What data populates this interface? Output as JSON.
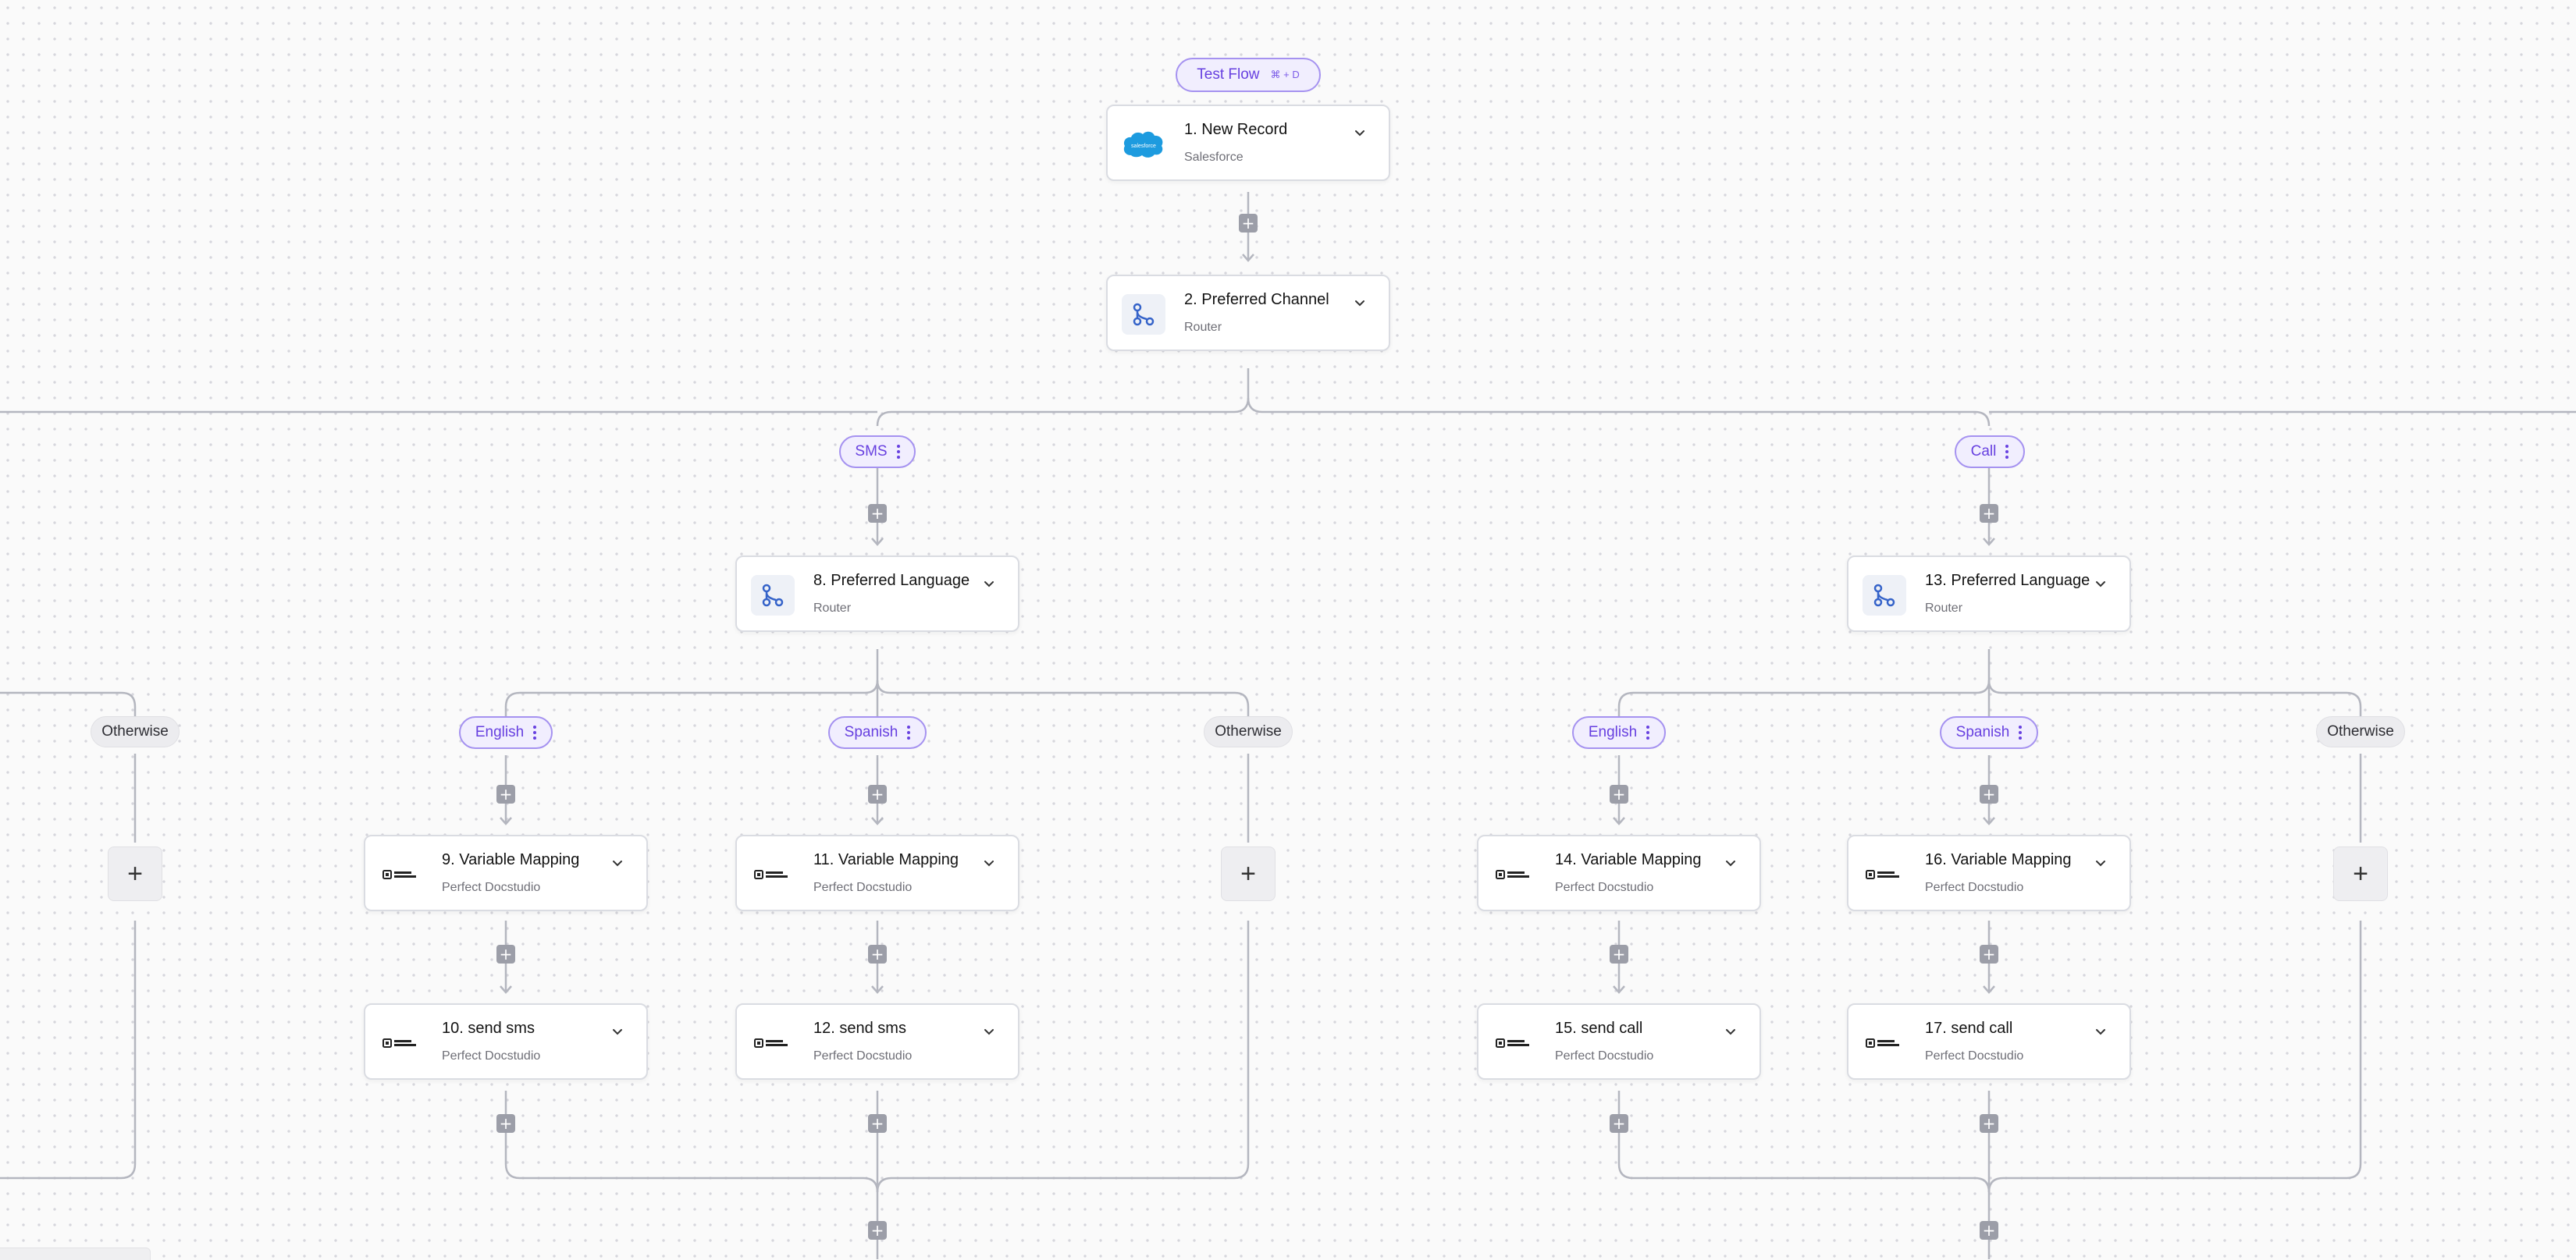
{
  "test_flow": {
    "label": "Test Flow",
    "shortcut": "⌘ + D"
  },
  "steps": [
    {
      "title": "1. New Record",
      "app": "Salesforce",
      "icon": "salesforce-logo-icon"
    },
    {
      "title": "2. Preferred Channel",
      "app": "Router",
      "icon": "router-icon"
    },
    {
      "title": "8. Preferred Language",
      "app": "Router",
      "icon": "router-icon"
    },
    {
      "title": "13. Preferred Language",
      "app": "Router",
      "icon": "router-icon"
    },
    {
      "title": "9. Variable Mapping",
      "app": "Perfect Docstudio",
      "icon": "perfect-docstudio-logo-icon"
    },
    {
      "title": "11. Variable Mapping",
      "app": "Perfect Docstudio",
      "icon": "perfect-docstudio-logo-icon"
    },
    {
      "title": "14. Variable Mapping",
      "app": "Perfect Docstudio",
      "icon": "perfect-docstudio-logo-icon"
    },
    {
      "title": "16. Variable Mapping",
      "app": "Perfect Docstudio",
      "icon": "perfect-docstudio-logo-icon"
    },
    {
      "title": "10. send sms",
      "app": "Perfect Docstudio",
      "icon": "perfect-docstudio-logo-icon"
    },
    {
      "title": "12. send sms",
      "app": "Perfect Docstudio",
      "icon": "perfect-docstudio-logo-icon"
    },
    {
      "title": "15. send call",
      "app": "Perfect Docstudio",
      "icon": "perfect-docstudio-logo-icon"
    },
    {
      "title": "17. send call",
      "app": "Perfect Docstudio",
      "icon": "perfect-docstudio-logo-icon"
    }
  ],
  "branches": [
    {
      "label": "SMS"
    },
    {
      "label": "Call"
    },
    {
      "label": "English"
    },
    {
      "label": "Spanish"
    },
    {
      "label": "English"
    },
    {
      "label": "Spanish"
    }
  ],
  "otherwise": [
    {
      "label": "Otherwise"
    },
    {
      "label": "Otherwise"
    },
    {
      "label": "Otherwise"
    }
  ],
  "add_step_symbol": "+",
  "colors": {
    "accent": "#6740e0",
    "pill_bg": "#f1eefe",
    "connector": "#b4b6bf",
    "plus_button": "#9c9ea8",
    "canvas": "#fafafa"
  }
}
